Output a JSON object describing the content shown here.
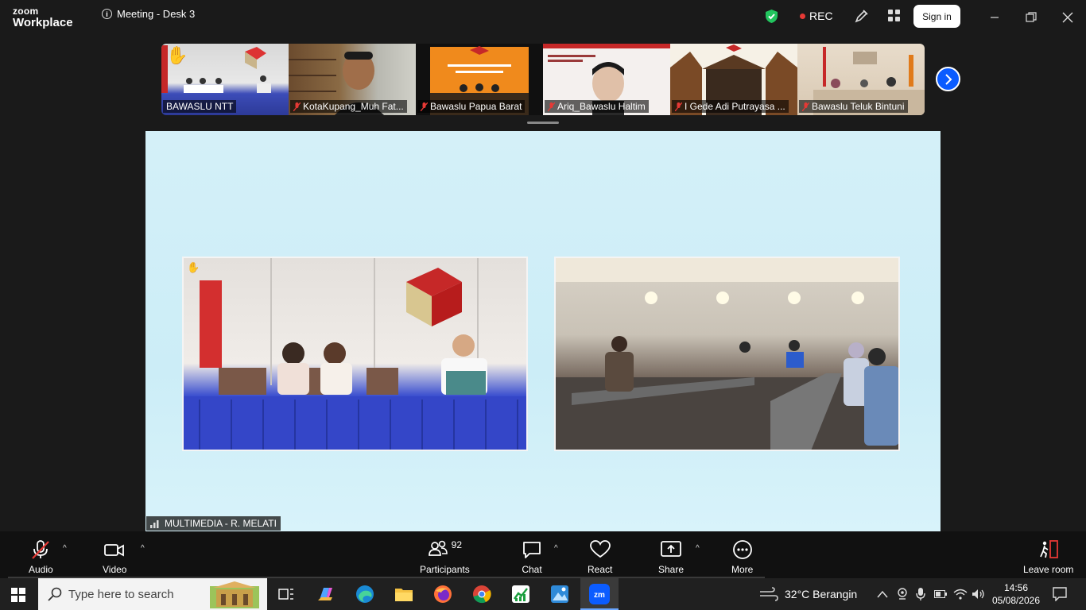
{
  "app": {
    "logo_line1": "zoom",
    "logo_line2": "Workplace",
    "meeting_title": "Meeting - Desk 3",
    "rec_label": "REC",
    "sign_in": "Sign in"
  },
  "thumbnails": [
    {
      "name": "BAWASLU NTT",
      "muted": false,
      "hand_raised": true
    },
    {
      "name": "KotaKupang_Muh Fat...",
      "muted": true
    },
    {
      "name": "Bawaslu Papua Barat",
      "muted": true
    },
    {
      "name": "Ariq_Bawaslu Haltim",
      "muted": true
    },
    {
      "name": "I Gede Adi Putrayasa ...",
      "muted": true
    },
    {
      "name": "Bawaslu Teluk Bintuni",
      "muted": true
    }
  ],
  "main_video": {
    "speaker_name": "MULTIMEDIA - R. MELATI"
  },
  "toolbar": {
    "audio": "Audio",
    "video": "Video",
    "participants": "Participants",
    "participants_count": "92",
    "chat": "Chat",
    "react": "React",
    "share": "Share",
    "more": "More",
    "leave": "Leave room"
  },
  "taskbar": {
    "search_placeholder": "Type here to search",
    "weather": "32°C  Berangin",
    "time": "14:56",
    "date": "05/08/2026"
  },
  "colors": {
    "accent": "#0b5cff",
    "rec": "#e53935",
    "shield": "#22c55e",
    "leave": "#e53935"
  }
}
